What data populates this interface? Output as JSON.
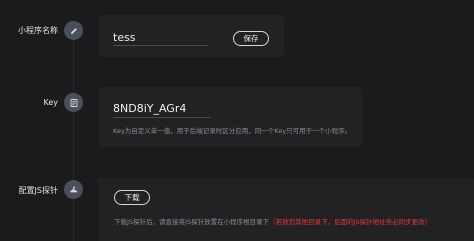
{
  "rows": {
    "name": {
      "label": "小程序名称",
      "icon": "edit-pencil-icon",
      "value": "tess",
      "save_label": "保存"
    },
    "key": {
      "label": "Key",
      "icon": "key-document-icon",
      "value": "8ND8iY_AGr4",
      "hint": "Key为自定义单一值，用于后端记录时区分应用，同一个Key只可用于一个小程序。"
    },
    "probe": {
      "label": "配置JS探针",
      "icon": "probe-cloud-icon",
      "download_label": "下载",
      "hint_normal": "下载JS探针后，请直接将JS探针放置在小程序根目录下",
      "hint_warning": "（若放到其他目录下，后面的JS探针地址务必同步更改）"
    }
  },
  "colors": {
    "background": "#1b1b1d",
    "card": "#222225",
    "icon_circle": "#4a4f59",
    "warning": "#e23b3b",
    "hint": "#8d8d92"
  }
}
